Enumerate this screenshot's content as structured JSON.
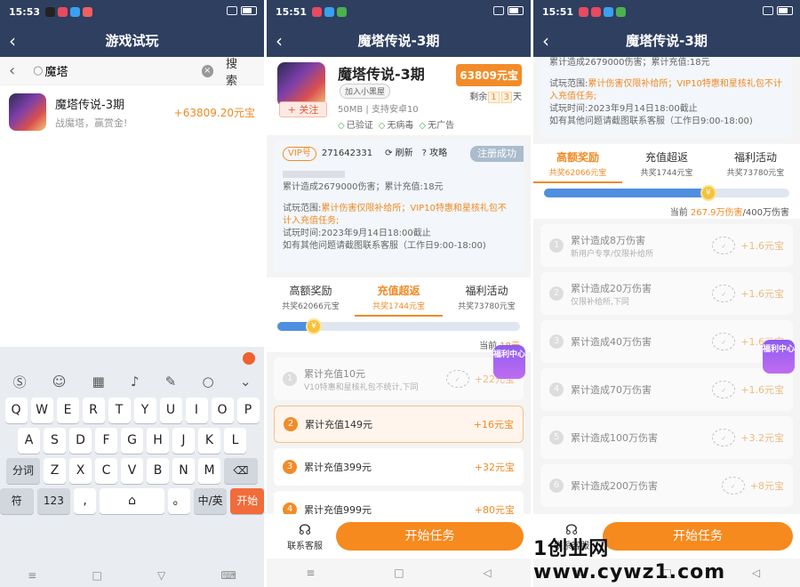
{
  "status": {
    "time1": "15:53",
    "time2": "15:51",
    "time3": "15:51"
  },
  "panel1": {
    "title": "游戏试玩",
    "search_value": "魔塔",
    "search_button": "搜索",
    "result": {
      "name": "魔塔传说-3期",
      "desc": "战魔塔，赢赏金!",
      "reward": "+63809.20元宝"
    },
    "keyboard": {
      "row1": [
        "Q",
        "W",
        "E",
        "R",
        "T",
        "Y",
        "U",
        "I",
        "O",
        "P"
      ],
      "row2": [
        "A",
        "S",
        "D",
        "F",
        "G",
        "H",
        "J",
        "K",
        "L"
      ],
      "row3": [
        "Z",
        "X",
        "C",
        "V",
        "B",
        "N",
        "M"
      ],
      "fenci": "分词",
      "fu": "符",
      "num": "123",
      "comma": ",",
      "period": "。",
      "lang": "中/英",
      "go": "开始"
    }
  },
  "game": {
    "title": "魔塔传说-3期",
    "name": "魔塔传说-3期",
    "follow": "+ 关注",
    "blacklist": "加入小黑屋",
    "meta": "50MB | 支持安卓10",
    "badges": [
      "已验证",
      "无病毒",
      "无广告"
    ],
    "price": "63809元宝",
    "remain_prefix": "剩余",
    "remain_d1": "1",
    "remain_d2": "3",
    "remain_suffix": "天",
    "vip_label": "VIP号",
    "vip_id": "271642331",
    "refresh": "刷新",
    "guide": "攻略",
    "registered": "注册成功",
    "stats": "累计造成2679000伤害；累计充值:18元",
    "scope_label": "试玩范围:",
    "scope_text": "累计伤害仅限补给所；VIP10特惠和星核礼包不计入充值任务;",
    "time_text": "试玩时间:2023年9月14日18:00截止",
    "help_text": "如有其他问题请截图联系客服（工作日9:00-18:00)",
    "tabs": [
      {
        "label": "高额奖励",
        "sub": "共奖62066元宝"
      },
      {
        "label": "充值超返",
        "sub": "共奖1744元宝"
      },
      {
        "label": "福利活动",
        "sub": "共奖73780元宝"
      }
    ],
    "customer_service": "联系客服",
    "start": "开始任务",
    "welfare": "福利中心"
  },
  "panel2": {
    "progress_prefix": "当前",
    "progress_value": "18元",
    "progress_fraction": 0.15,
    "tasks": [
      {
        "num": "1",
        "name": "累计充值10元",
        "sub": "V10特惠和星核礼包不统计,下同",
        "reward": "+22元宝",
        "done": true
      },
      {
        "num": "2",
        "name": "累计充值149元",
        "sub": "",
        "reward": "+16元宝",
        "done": false
      },
      {
        "num": "3",
        "name": "累计充值399元",
        "sub": "",
        "reward": "+32元宝",
        "done": false
      },
      {
        "num": "4",
        "name": "累计充值999元",
        "sub": "",
        "reward": "+80元宝",
        "done": false
      }
    ]
  },
  "panel3": {
    "progress_prefix": "当前",
    "progress_value": "267.9万伤害",
    "progress_total": "/400万伤害",
    "progress_fraction": 0.67,
    "tasks": [
      {
        "num": "1",
        "name": "累计造成8万伤害",
        "sub": "新用户专享/仅限补给所",
        "reward": "+1.6元宝"
      },
      {
        "num": "2",
        "name": "累计造成20万伤害",
        "sub": "仅限补给所,下同",
        "reward": "+1.6元宝"
      },
      {
        "num": "3",
        "name": "累计造成40万伤害",
        "sub": "",
        "reward": "+1.6元宝"
      },
      {
        "num": "4",
        "name": "累计造成70万伤害",
        "sub": "",
        "reward": "+1.6元宝"
      },
      {
        "num": "5",
        "name": "累计造成100万伤害",
        "sub": "",
        "reward": "+3.2元宝"
      },
      {
        "num": "6",
        "name": "累计造成200万伤害",
        "sub": "",
        "reward": "+8元宝"
      }
    ]
  },
  "watermark": "1创业网www.cywz1.com"
}
